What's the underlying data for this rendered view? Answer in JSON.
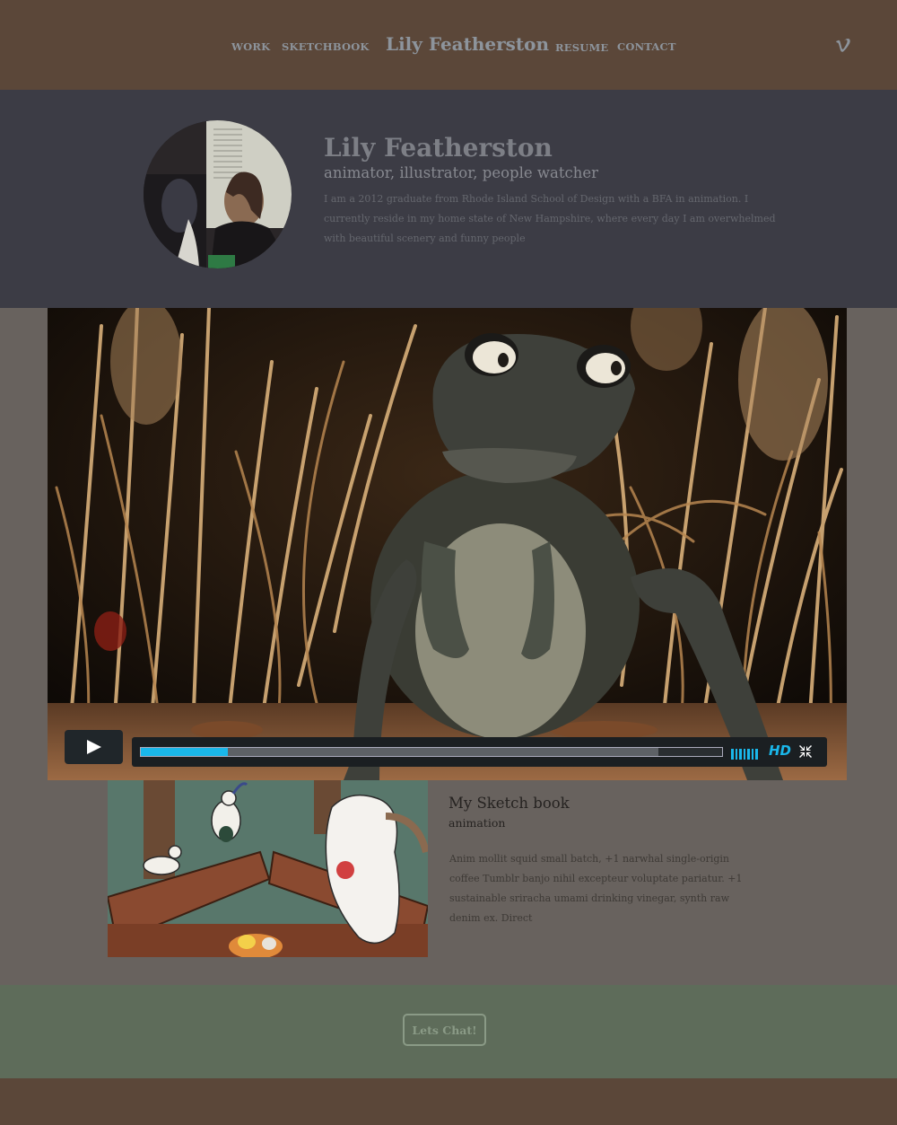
{
  "nav": {
    "work": "WORK",
    "sketchbook": "SKETCHBOOK",
    "title": "Lily Featherston",
    "resume": "RESUME",
    "contact": "CONTACT",
    "social_icon": "vimeo-icon"
  },
  "profile": {
    "name": "Lily Featherston",
    "tagline": "animator, illustrator, people watcher",
    "bio": "I am a 2012 graduate from Rhode Island School of Design with a BFA in animation. I currently reside in my home state of New Hampshire, where every day I am overwhelmed with beautiful scenery and funny people"
  },
  "video": {
    "played_fraction": 0.15,
    "buffered_fraction": 0.89,
    "hd_label": "HD",
    "accent_color": "#1ab7ea"
  },
  "sketchbook": {
    "title": "My Sketch book",
    "subtitle": "animation",
    "body": "Anim mollit squid small batch, +1 narwhal single-origin coffee Tumblr banjo nihil excepteur voluptate pariatur. +1 sustainable sriracha umami drinking vinegar, synth raw denim ex. Direct"
  },
  "cta": {
    "button_label": "Lets Chat!"
  },
  "colors": {
    "nav_bg": "#5b4739",
    "profile_bg": "#3c3c45",
    "content_bg": "#68625e",
    "cta_bg": "#5e6c5a"
  }
}
